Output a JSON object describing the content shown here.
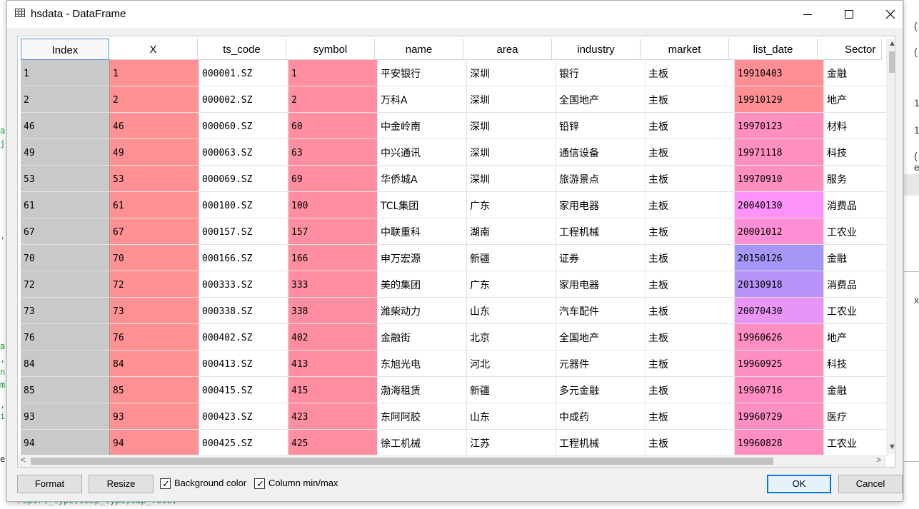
{
  "window": {
    "title": "hsdata - DataFrame"
  },
  "table": {
    "columns": [
      "Index",
      "X",
      "ts_code",
      "symbol",
      "name",
      "area",
      "industry",
      "market",
      "list_date",
      "Sector"
    ],
    "rows": [
      {
        "index": "1",
        "x": "1",
        "ts_code": "000001.SZ",
        "symbol": "1",
        "name": "平安银行",
        "area": "深圳",
        "industry": "银行",
        "market": "主板",
        "list_date": "19910403",
        "sector": "金融",
        "date_color": "#ff8f95"
      },
      {
        "index": "2",
        "x": "2",
        "ts_code": "000002.SZ",
        "symbol": "2",
        "name": "万科A",
        "area": "深圳",
        "industry": "全国地产",
        "market": "主板",
        "list_date": "19910129",
        "sector": "地产",
        "date_color": "#ff8f95"
      },
      {
        "index": "46",
        "x": "46",
        "ts_code": "000060.SZ",
        "symbol": "60",
        "name": "中金岭南",
        "area": "深圳",
        "industry": "铅锌",
        "market": "主板",
        "list_date": "19970123",
        "sector": "材料",
        "date_color": "#ff8fbe"
      },
      {
        "index": "49",
        "x": "49",
        "ts_code": "000063.SZ",
        "symbol": "63",
        "name": "中兴通讯",
        "area": "深圳",
        "industry": "通信设备",
        "market": "主板",
        "list_date": "19971118",
        "sector": "科技",
        "date_color": "#ff8fbe"
      },
      {
        "index": "53",
        "x": "53",
        "ts_code": "000069.SZ",
        "symbol": "69",
        "name": "华侨城A",
        "area": "深圳",
        "industry": "旅游景点",
        "market": "主板",
        "list_date": "19970910",
        "sector": "服务",
        "date_color": "#ff8fbe"
      },
      {
        "index": "61",
        "x": "61",
        "ts_code": "000100.SZ",
        "symbol": "100",
        "name": "TCL集团",
        "area": "广东",
        "industry": "家用电器",
        "market": "主板",
        "list_date": "20040130",
        "sector": "消费品",
        "date_color": "#fd92f8"
      },
      {
        "index": "67",
        "x": "67",
        "ts_code": "000157.SZ",
        "symbol": "157",
        "name": "中联重科",
        "area": "湖南",
        "industry": "工程机械",
        "market": "主板",
        "list_date": "20001012",
        "sector": "工农业",
        "date_color": "#ff8fd6"
      },
      {
        "index": "70",
        "x": "70",
        "ts_code": "000166.SZ",
        "symbol": "166",
        "name": "申万宏源",
        "area": "新疆",
        "industry": "证券",
        "market": "主板",
        "list_date": "20150126",
        "sector": "金融",
        "date_color": "#a597f7"
      },
      {
        "index": "72",
        "x": "72",
        "ts_code": "000333.SZ",
        "symbol": "333",
        "name": "美的集团",
        "area": "广东",
        "industry": "家用电器",
        "market": "主板",
        "list_date": "20130918",
        "sector": "消费品",
        "date_color": "#b893f7"
      },
      {
        "index": "73",
        "x": "73",
        "ts_code": "000338.SZ",
        "symbol": "338",
        "name": "潍柴动力",
        "area": "山东",
        "industry": "汽车配件",
        "market": "主板",
        "list_date": "20070430",
        "sector": "工农业",
        "date_color": "#e895f7"
      },
      {
        "index": "76",
        "x": "76",
        "ts_code": "000402.SZ",
        "symbol": "402",
        "name": "金融街",
        "area": "北京",
        "industry": "全国地产",
        "market": "主板",
        "list_date": "19960626",
        "sector": "地产",
        "date_color": "#ff8fc2"
      },
      {
        "index": "84",
        "x": "84",
        "ts_code": "000413.SZ",
        "symbol": "413",
        "name": "东旭光电",
        "area": "河北",
        "industry": "元器件",
        "market": "主板",
        "list_date": "19960925",
        "sector": "科技",
        "date_color": "#ff8fc2"
      },
      {
        "index": "85",
        "x": "85",
        "ts_code": "000415.SZ",
        "symbol": "415",
        "name": "渤海租赁",
        "area": "新疆",
        "industry": "多元金融",
        "market": "主板",
        "list_date": "19960716",
        "sector": "金融",
        "date_color": "#ff8fc2"
      },
      {
        "index": "93",
        "x": "93",
        "ts_code": "000423.SZ",
        "symbol": "423",
        "name": "东阿阿胶",
        "area": "山东",
        "industry": "中成药",
        "market": "主板",
        "list_date": "19960729",
        "sector": "医疗",
        "date_color": "#ff8fc2"
      },
      {
        "index": "94",
        "x": "94",
        "ts_code": "000425.SZ",
        "symbol": "425",
        "name": "徐工机械",
        "area": "江苏",
        "industry": "工程机械",
        "market": "主板",
        "list_date": "19960828",
        "sector": "工农业",
        "date_color": "#ff8fc2"
      }
    ]
  },
  "buttons": {
    "format": "Format",
    "resize": "Resize",
    "ok": "OK",
    "cancel": "Cancel"
  },
  "checkboxes": {
    "background_color": "Background color",
    "column_minmax": "Column min/max",
    "checked_mark": "✓"
  },
  "scroll_arrows": {
    "up": "▲",
    "down": "▼",
    "left": "<",
    "right": ">"
  },
  "background": {
    "left_fragments": [
      "a",
      "j",
      "a",
      "'",
      "a",
      ",",
      "n",
      "m",
      ",",
      "i",
      "e"
    ],
    "right_fragments": [
      "(",
      "(",
      "1",
      "1",
      "(",
      "e",
      "x"
    ],
    "bottom_code": "report_type,comp_type,cap_rese,"
  },
  "icons": {
    "table": "table-icon",
    "minimize": "minimize-icon",
    "maximize": "maximize-icon",
    "close": "close-icon"
  },
  "colors": {
    "x_col": "#ff9194",
    "symbol_col": "#ff8fa0",
    "index_col": "#c9c9c9",
    "accent": "#0078d7"
  }
}
